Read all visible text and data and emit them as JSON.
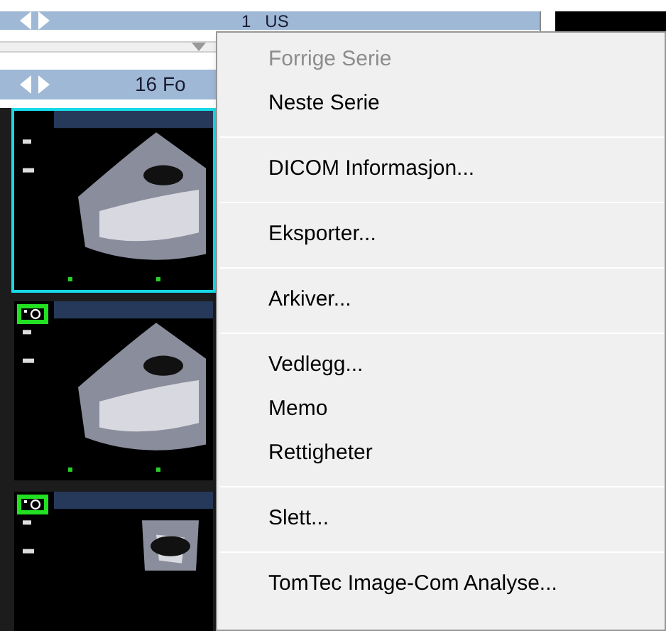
{
  "series_bar": {
    "label": "1   US"
  },
  "study_bar": {
    "label": "16 Fo"
  },
  "thumbnails": [
    {
      "selected": true,
      "marked": false
    },
    {
      "selected": false,
      "marked": true
    },
    {
      "selected": false,
      "marked": true
    }
  ],
  "context_menu": {
    "groups": [
      [
        {
          "label": "Forrige Serie",
          "disabled": true
        },
        {
          "label": "Neste Serie",
          "disabled": false
        }
      ],
      [
        {
          "label": "DICOM Informasjon...",
          "disabled": false
        }
      ],
      [
        {
          "label": "Eksporter...",
          "disabled": false
        }
      ],
      [
        {
          "label": "Arkiver...",
          "disabled": false
        }
      ],
      [
        {
          "label": "Vedlegg...",
          "disabled": false
        },
        {
          "label": "Memo",
          "disabled": false
        },
        {
          "label": "Rettigheter",
          "disabled": false
        }
      ],
      [
        {
          "label": "Slett...",
          "disabled": false
        }
      ],
      [
        {
          "label": "TomTec Image-Com Analyse...",
          "disabled": false
        }
      ]
    ]
  }
}
